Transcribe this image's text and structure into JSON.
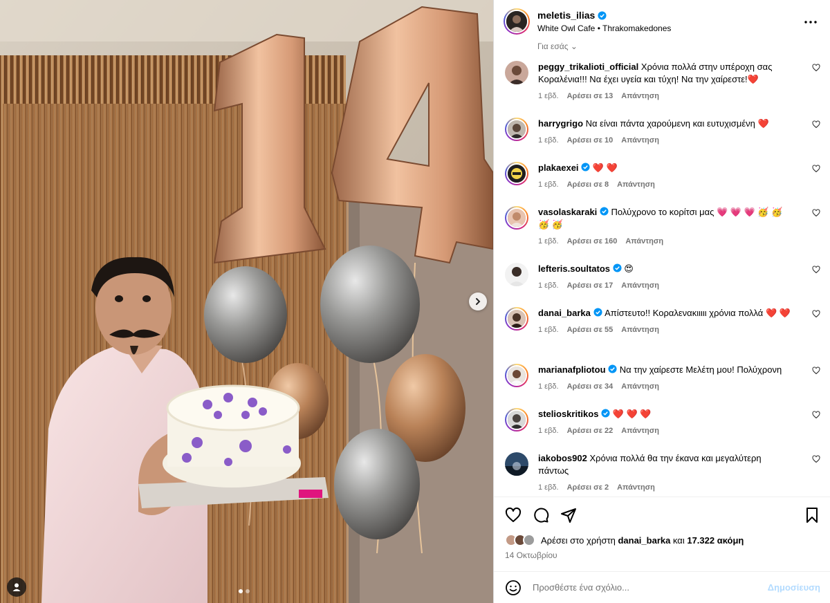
{
  "colors": {
    "accent": "#0095f6",
    "heart": "#ed2e45",
    "verified": "#0095f6",
    "muted": "#737373"
  },
  "header": {
    "username": "meletis_ilias",
    "verified": true,
    "location": "White Owl Cafe • Thrakomakedones"
  },
  "partial_link": "Για εσάς",
  "comments": [
    {
      "username": "peggy_trikalioti_official",
      "verified": false,
      "text": "Χρόνια πολλά στην υπέροχη σας Κοραλένια!!! Να έχει υγεία και τύχη! Να την χαίρεστε!",
      "emojis": "❤️",
      "time": "1 εβδ.",
      "likes": "Αρέσει σε 13",
      "reply": "Απάντηση"
    },
    {
      "username": "harrygrigo",
      "verified": false,
      "text": "Να είναι πάντα χαρούμενη και ευτυχισμένη",
      "emojis": "❤️",
      "time": "1 εβδ.",
      "likes": "Αρέσει σε 10",
      "reply": "Απάντηση"
    },
    {
      "username": "plakaexei",
      "verified": true,
      "text": "",
      "emojis": "❤️ ❤️",
      "time": "1 εβδ.",
      "likes": "Αρέσει σε 8",
      "reply": "Απάντηση"
    },
    {
      "username": "vasolaskaraki",
      "verified": true,
      "text": "Πολύχρονο το κορίτσι μας",
      "emojis": "💗 💗 💗 🥳 🥳 🥳 🥳",
      "time": "1 εβδ.",
      "likes": "Αρέσει σε 160",
      "reply": "Απάντηση"
    },
    {
      "username": "lefteris.soultatos",
      "verified": true,
      "text": "",
      "emojis": "😍",
      "time": "1 εβδ.",
      "likes": "Αρέσει σε 17",
      "reply": "Απάντηση"
    },
    {
      "username": "danai_barka",
      "verified": true,
      "text": "Απίστευτο!! Κοραλενακιιιιι χρόνια πολλά",
      "emojis": "❤️ ❤️",
      "time": "1 εβδ.",
      "likes": "Αρέσει σε 55",
      "reply": "Απάντηση"
    },
    {
      "username": "marianafpliotou",
      "verified": true,
      "text": "Να την χαίρεστε Μελέτη μου! Πολύχρονη",
      "emojis": "",
      "time": "1 εβδ.",
      "likes": "Αρέσει σε 34",
      "reply": "Απάντηση"
    },
    {
      "username": "stelioskritikos",
      "verified": true,
      "text": "",
      "emojis": "❤️ ❤️ ❤️",
      "time": "1 εβδ.",
      "likes": "Αρέσει σε 22",
      "reply": "Απάντηση"
    },
    {
      "username": "iakobos902",
      "verified": false,
      "text": "Χρόνια πολλά θα την έκανα και μεγαλύτερη πάντως",
      "emojis": "",
      "time": "1 εβδ.",
      "likes": "Αρέσει σε 2",
      "reply": "Απάντηση"
    }
  ],
  "likes": {
    "prefix": "Αρέσει στο χρήστη",
    "user": "danai_barka",
    "middle": "και",
    "count": "17.322 ακόμη"
  },
  "date": "14 Οκτωβρίου",
  "composer": {
    "placeholder": "Προσθέστε ένα σχόλιο...",
    "post_label": "Δημοσίευση"
  },
  "icons": [
    "more-icon",
    "verified-icon",
    "heart-icon",
    "comment-icon",
    "share-icon",
    "bookmark-icon",
    "emoji-icon",
    "chevron-right-icon",
    "user-tag-icon"
  ]
}
